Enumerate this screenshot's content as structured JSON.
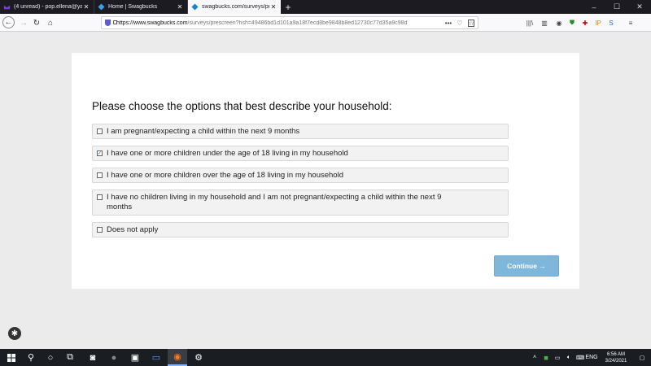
{
  "tabs": [
    {
      "title": "(4 unread) - pop.ellena@yahoo",
      "icon": "yahoo-mail-icon",
      "color": "#6001d2"
    },
    {
      "title": "Home | Swagbucks",
      "icon": "swagbucks-icon",
      "color": "#1a86c8"
    },
    {
      "title": "swagbucks.com/surveys/prescre",
      "icon": "swagbucks-icon",
      "color": "#1a86c8"
    }
  ],
  "window": {
    "minimize": "–",
    "maximize": "☐",
    "close": "✕"
  },
  "nav": {
    "back": "←",
    "forward": "→",
    "reload": "↻",
    "home": "⌂",
    "url_host": "https://www.swagbucks.com",
    "url_rest": "/surveys/prescreen?hsh=49486bd1d101a9a18f7ecd8be9848b8ed12730c77d35a9c98d"
  },
  "survey": {
    "question": "Please choose the options that best describe your household:",
    "options": [
      {
        "label": "I am pregnant/expecting a child within the next 9 months",
        "checked": false
      },
      {
        "label": "I have one or more children under the age of 18 living in my household",
        "checked": true
      },
      {
        "label": "I have one or more children over the age of 18 living in my household",
        "checked": false
      },
      {
        "label": "I have no children living in my household and I am not pregnant/expecting a child within the next 9 months",
        "checked": false
      },
      {
        "label": "Does not apply",
        "checked": false
      }
    ],
    "continue_label": "Continue →"
  },
  "taskbar": {
    "lang": "ENG",
    "time": "6:56 AM",
    "date": "3/24/2021"
  },
  "colors": {
    "accent": "#7fb6dc",
    "active_tab": "#f9f9fb",
    "tabstrip": "#1c1b22"
  }
}
